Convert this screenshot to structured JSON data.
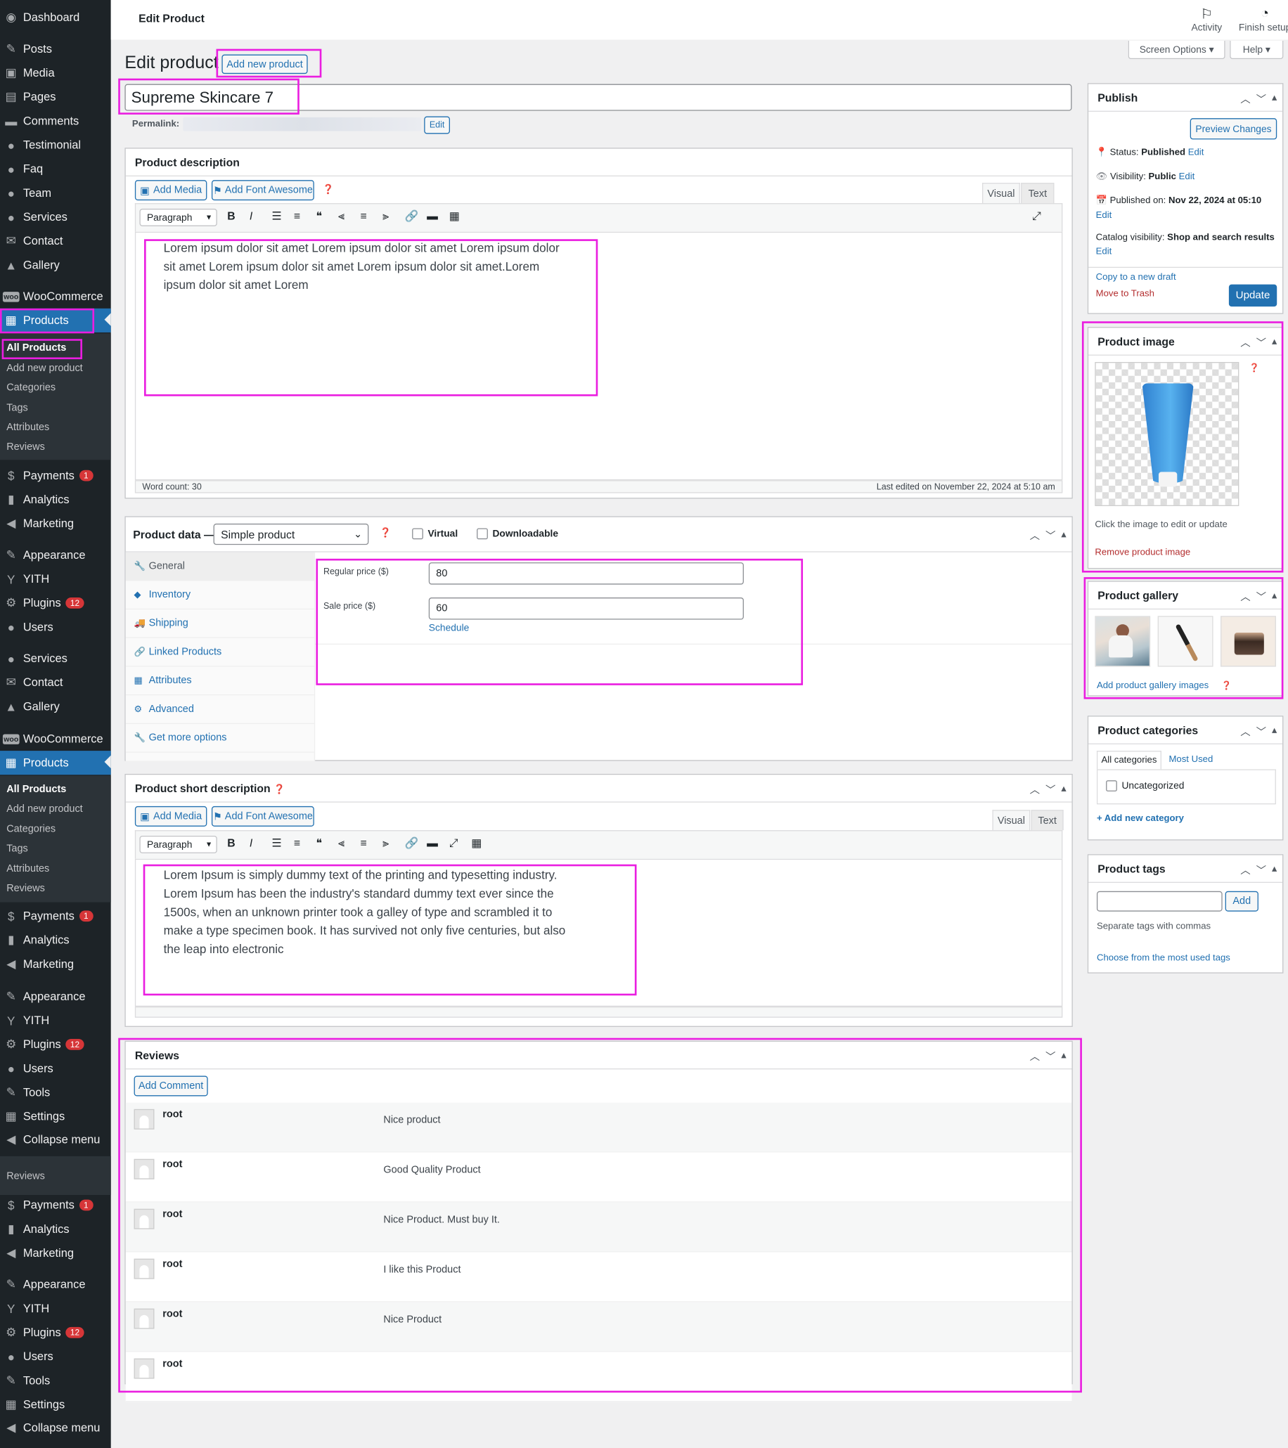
{
  "topbar": {
    "title": "Edit Product",
    "activity": "Activity",
    "finish_setup": "Finish setup",
    "screen_options": "Screen Options ▾",
    "help": "Help ▾"
  },
  "sidebar": {
    "group1": [
      "Dashboard",
      "Posts",
      "Media",
      "Pages",
      "Comments",
      "Testimonial",
      "Faq",
      "Team",
      "Services",
      "Contact",
      "Gallery",
      "WooCommerce",
      "Products"
    ],
    "submenu": [
      "All Products",
      "Add new product",
      "Categories",
      "Tags",
      "Attributes",
      "Reviews"
    ],
    "group2": [
      "Payments",
      "Analytics",
      "Marketing",
      "Appearance",
      "YITH",
      "Plugins",
      "Users"
    ],
    "group3": [
      "Services",
      "Contact",
      "Gallery",
      "WooCommerce",
      "Products"
    ],
    "group4": [
      "Payments",
      "Analytics",
      "Marketing",
      "Appearance",
      "YITH",
      "Plugins",
      "Users",
      "Tools",
      "Settings",
      "Collapse menu"
    ],
    "reviews_sub": "Reviews",
    "group5": [
      "Payments",
      "Analytics",
      "Marketing",
      "Appearance",
      "YITH",
      "Plugins",
      "Users",
      "Tools",
      "Settings",
      "Collapse menu"
    ],
    "badge_payments": "1",
    "badge_plugins": "12"
  },
  "heading": {
    "title": "Edit product",
    "add_new": "Add new product"
  },
  "product": {
    "name": "Supreme Skincare 7",
    "permalink_label": "Permalink:",
    "permalink_edit": "Edit"
  },
  "description": {
    "title": "Product description",
    "add_media": "Add Media",
    "add_font": "Add Font Awesome",
    "tab_visual": "Visual",
    "tab_text": "Text",
    "format": "Paragraph",
    "body": "Lorem ipsum dolor sit amet Lorem ipsum dolor sit amet Lorem ipsum dolor sit amet Lorem ipsum dolor sit amet Lorem ipsum dolor sit amet.Lorem ipsum dolor sit amet Lorem",
    "word_count": "Word count: 30",
    "last_edited": "Last edited on November 22, 2024 at 5:10 am"
  },
  "product_data": {
    "title": "Product data —",
    "type": "Simple product",
    "virtual": "Virtual",
    "downloadable": "Downloadable",
    "tabs": [
      "General",
      "Inventory",
      "Shipping",
      "Linked Products",
      "Attributes",
      "Advanced",
      "Get more options"
    ],
    "regular_label": "Regular price ($)",
    "regular_value": "80",
    "sale_label": "Sale price ($)",
    "sale_value": "60",
    "schedule": "Schedule"
  },
  "short_description": {
    "title": "Product short description",
    "add_media": "Add Media",
    "add_font": "Add Font Awesome",
    "tab_visual": "Visual",
    "tab_text": "Text",
    "format": "Paragraph",
    "body": "Lorem Ipsum is simply dummy text of the printing and typesetting industry. Lorem Ipsum has been the industry's standard dummy text ever since the 1500s, when an unknown printer took a galley of type and scrambled it to make a type specimen book. It has survived not only five centuries, but also the leap into electronic"
  },
  "reviews": {
    "title": "Reviews",
    "add_comment": "Add Comment",
    "items": [
      {
        "author": "root",
        "text": "Nice product"
      },
      {
        "author": "root",
        "text": "Good Quality Product"
      },
      {
        "author": "root",
        "text": "Nice Product. Must buy It."
      },
      {
        "author": "root",
        "text": "I like this Product"
      },
      {
        "author": "root",
        "text": "Nice Product"
      },
      {
        "author": "root",
        "text": ""
      }
    ]
  },
  "publish": {
    "title": "Publish",
    "preview": "Preview Changes",
    "status_label": "Status:",
    "status_value": "Published",
    "status_edit": "Edit",
    "visibility_label": "Visibility:",
    "visibility_value": "Public",
    "visibility_edit": "Edit",
    "published_label": "Published on:",
    "published_value": "Nov 22, 2024 at 05:10",
    "published_edit": "Edit",
    "catalog_label": "Catalog visibility:",
    "catalog_value": "Shop and search results",
    "catalog_edit": "Edit",
    "copy_draft": "Copy to a new draft",
    "trash": "Move to Trash",
    "update": "Update"
  },
  "product_image": {
    "title": "Product image",
    "hint": "Click the image to edit or update",
    "remove": "Remove product image"
  },
  "gallery": {
    "title": "Product gallery",
    "add": "Add product gallery images"
  },
  "categories": {
    "title": "Product categories",
    "tab_all": "All categories",
    "tab_used": "Most Used",
    "item": "Uncategorized",
    "add": "+ Add new category"
  },
  "tags": {
    "title": "Product tags",
    "add": "Add",
    "hint": "Separate tags with commas",
    "choose": "Choose from the most used tags"
  },
  "colors": {
    "accent": "#2271b1",
    "highlight": "#ea1ee0",
    "sidebar": "#1d2327",
    "danger": "#b32d2e"
  }
}
